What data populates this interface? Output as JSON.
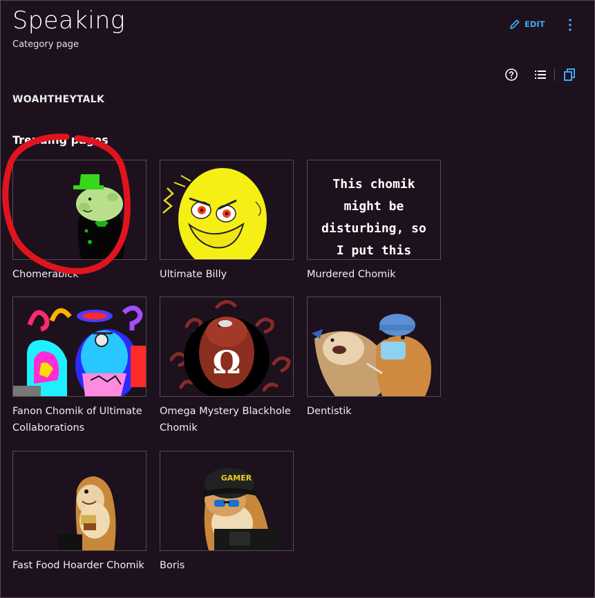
{
  "header": {
    "title": "Speaking",
    "subtitle": "Category page",
    "edit_label": "EDIT"
  },
  "description": "WOAHTHEYTALK",
  "section_title": "Trending pages",
  "cards": [
    {
      "label": "Chomerabick",
      "thumb": "chomerabick-image"
    },
    {
      "label": "Ultimate Billy",
      "thumb": "ultimate-billy-image"
    },
    {
      "label": "Murdered Chomik",
      "thumb": "murdered-chomik-image",
      "thumb_text": "This chomik might be disturbing, so I put this"
    },
    {
      "label": "Fanon Chomik of Ultimate Collaborations",
      "thumb": "fanon-chomik-image"
    },
    {
      "label": "Omega Mystery Blackhole Chomik",
      "thumb": "omega-chomik-image"
    },
    {
      "label": "Dentistik",
      "thumb": "dentistik-image"
    },
    {
      "label": "Fast Food Hoarder Chomik",
      "thumb": "fast-food-chomik-image"
    },
    {
      "label": "Boris",
      "thumb": "boris-image",
      "thumb_text": "GAMER"
    }
  ],
  "icons": [
    "pencil-icon",
    "more-vertical-icon",
    "help-icon",
    "list-icon",
    "copy-icon"
  ],
  "colors": {
    "background": "#1c111c",
    "accent": "#3fa9f5",
    "annotation": "#e0141e"
  }
}
